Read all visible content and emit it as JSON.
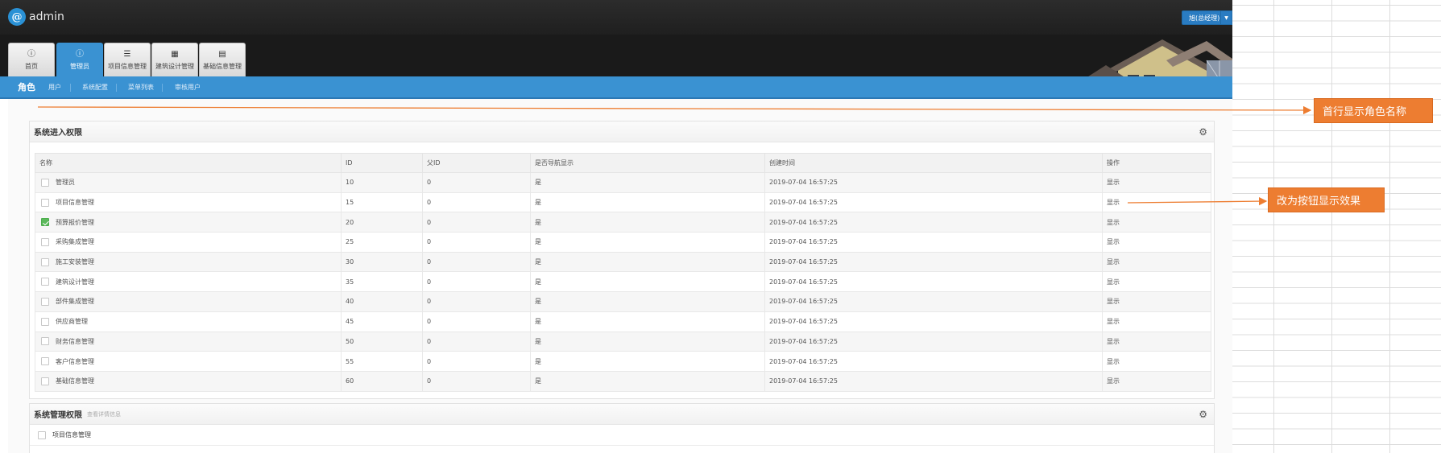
{
  "app": {
    "logo_mark": "@",
    "name": "admin",
    "user_menu": "旭(总经理)"
  },
  "tabs": [
    {
      "label": "首页",
      "icon": "info-circle-icon"
    },
    {
      "label": "管理员",
      "icon": "info-circle-icon",
      "active": true
    },
    {
      "label": "项目信息管理",
      "icon": "list-icon"
    },
    {
      "label": "建筑设计管理",
      "icon": "table-icon"
    },
    {
      "label": "基础信息管理",
      "icon": "calendar-icon"
    }
  ],
  "subnav": [
    {
      "label": "角色",
      "active": true
    },
    {
      "label": "用户"
    },
    {
      "label": "系统配置"
    },
    {
      "label": "菜单列表"
    },
    {
      "label": "审核用户"
    }
  ],
  "panel1": {
    "title": "系统进入权限",
    "columns": [
      "名称",
      "ID",
      "父ID",
      "是否导航显示",
      "创建时间",
      "操作"
    ],
    "rows": [
      {
        "checked": false,
        "name": "管理员",
        "id": "10",
        "pid": "0",
        "nav": "是",
        "created": "2019-07-04 16:57:25",
        "op": "显示"
      },
      {
        "checked": false,
        "name": "项目信息管理",
        "id": "15",
        "pid": "0",
        "nav": "是",
        "created": "2019-07-04 16:57:25",
        "op": "显示"
      },
      {
        "checked": true,
        "name": "预算报价管理",
        "id": "20",
        "pid": "0",
        "nav": "是",
        "created": "2019-07-04 16:57:25",
        "op": "显示"
      },
      {
        "checked": false,
        "name": "采购集成管理",
        "id": "25",
        "pid": "0",
        "nav": "是",
        "created": "2019-07-04 16:57:25",
        "op": "显示"
      },
      {
        "checked": false,
        "name": "施工安装管理",
        "id": "30",
        "pid": "0",
        "nav": "是",
        "created": "2019-07-04 16:57:25",
        "op": "显示"
      },
      {
        "checked": false,
        "name": "建筑设计管理",
        "id": "35",
        "pid": "0",
        "nav": "是",
        "created": "2019-07-04 16:57:25",
        "op": "显示"
      },
      {
        "checked": false,
        "name": "部件集成管理",
        "id": "40",
        "pid": "0",
        "nav": "是",
        "created": "2019-07-04 16:57:25",
        "op": "显示"
      },
      {
        "checked": false,
        "name": "供应商管理",
        "id": "45",
        "pid": "0",
        "nav": "是",
        "created": "2019-07-04 16:57:25",
        "op": "显示"
      },
      {
        "checked": false,
        "name": "财务信息管理",
        "id": "50",
        "pid": "0",
        "nav": "是",
        "created": "2019-07-04 16:57:25",
        "op": "显示"
      },
      {
        "checked": false,
        "name": "客户信息管理",
        "id": "55",
        "pid": "0",
        "nav": "是",
        "created": "2019-07-04 16:57:25",
        "op": "显示"
      },
      {
        "checked": false,
        "name": "基础信息管理",
        "id": "60",
        "pid": "0",
        "nav": "是",
        "created": "2019-07-04 16:57:25",
        "op": "显示"
      }
    ]
  },
  "panel2": {
    "title": "系统管理权限",
    "subtitle": "查看详情信息",
    "rows": [
      {
        "checked": false,
        "name": "项目信息管理"
      }
    ]
  },
  "annotations": {
    "callout1": "首行显示角色名称",
    "callout2": "改为按钮显示效果",
    "color": "#ed7d31"
  },
  "colors": {
    "topbar": "#262626",
    "accent": "#3a92d2",
    "checked": "#5cb85c"
  }
}
